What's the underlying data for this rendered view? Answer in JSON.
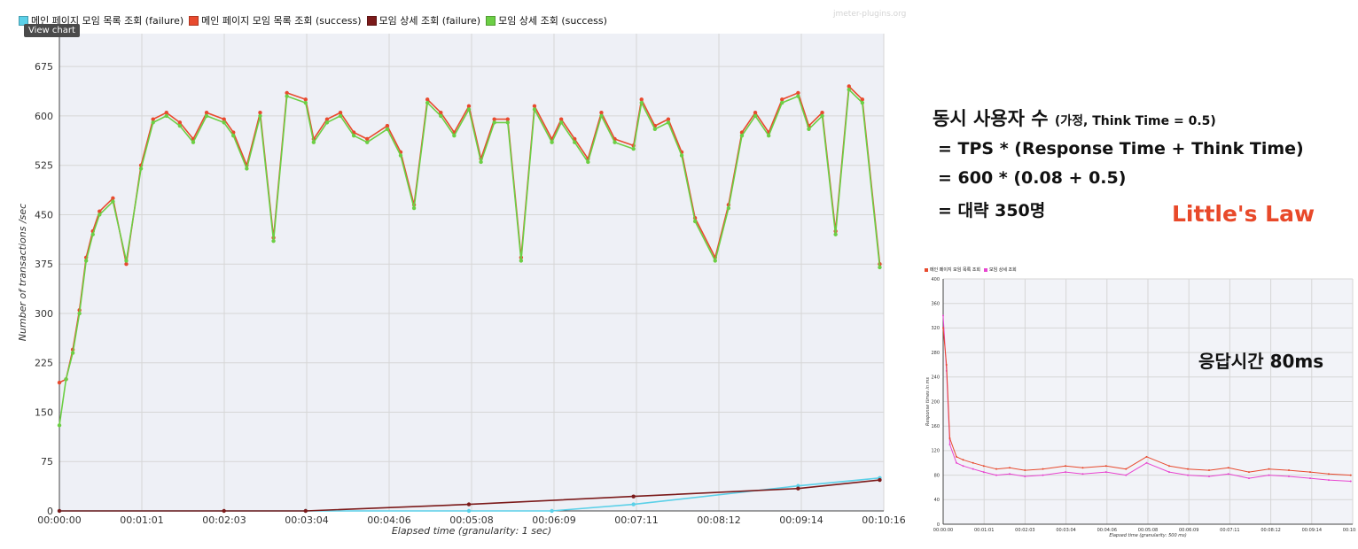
{
  "main_chart": {
    "legend": [
      {
        "label": "메인 페이지 모임 목록 조회 (failure)",
        "color": "#5bd0e8"
      },
      {
        "label": "메인 페이지 모임 목록 조회 (success)",
        "color": "#e84a2e"
      },
      {
        "label": "모임 상세 조회 (failure)",
        "color": "#7b1a1a"
      },
      {
        "label": "모임 상세 조회 (success)",
        "color": "#6ccf45"
      }
    ],
    "view_chart_label": "View chart",
    "watermark": "jmeter-plugins.org",
    "ylabel": "Number of transactions /sec",
    "xlabel": "Elapsed time (granularity: 1 sec)",
    "y_ticks": [
      "0",
      "75",
      "150",
      "225",
      "300",
      "375",
      "450",
      "525",
      "600",
      "675"
    ],
    "x_ticks": [
      "00:00:00",
      "00:01:01",
      "00:02:03",
      "00:03:04",
      "00:04:06",
      "00:05:08",
      "00:06:09",
      "00:07:11",
      "00:08:12",
      "00:09:14",
      "00:10:16"
    ]
  },
  "chart_data": [
    {
      "type": "line",
      "title": "",
      "xlabel": "Elapsed time (granularity: 1 sec)",
      "ylabel": "Number of transactions /sec",
      "x_unit": "seconds",
      "xlim": [
        0,
        616
      ],
      "ylim": [
        0,
        725
      ],
      "grid": true,
      "legend_position": "top-left",
      "series": [
        {
          "name": "모임 상세 조회 (success)",
          "color": "#6ccf45",
          "x": [
            0,
            5,
            10,
            15,
            20,
            25,
            30,
            40,
            50,
            61,
            70,
            80,
            90,
            100,
            110,
            123,
            130,
            140,
            150,
            160,
            170,
            184,
            190,
            200,
            210,
            220,
            230,
            245,
            255,
            265,
            275,
            285,
            295,
            306,
            315,
            325,
            335,
            345,
            355,
            368,
            375,
            385,
            395,
            405,
            415,
            429,
            435,
            445,
            455,
            465,
            475,
            490,
            500,
            510,
            520,
            530,
            540,
            552,
            560,
            570,
            580,
            590,
            600,
            613
          ],
          "y": [
            130,
            200,
            240,
            300,
            380,
            420,
            450,
            470,
            380,
            520,
            590,
            600,
            585,
            560,
            600,
            590,
            570,
            520,
            600,
            410,
            630,
            620,
            560,
            590,
            600,
            570,
            560,
            580,
            540,
            460,
            620,
            600,
            570,
            610,
            530,
            590,
            590,
            380,
            610,
            560,
            590,
            560,
            530,
            600,
            560,
            550,
            620,
            580,
            590,
            540,
            440,
            380,
            460,
            570,
            600,
            570,
            620,
            630,
            580,
            600,
            420,
            640,
            620,
            370
          ]
        },
        {
          "name": "메인 페이지 모임 목록 조회 (success)",
          "color": "#e84a2e",
          "x": [
            0,
            5,
            10,
            15,
            20,
            25,
            30,
            40,
            50,
            61,
            70,
            80,
            90,
            100,
            110,
            123,
            130,
            140,
            150,
            160,
            170,
            184,
            190,
            200,
            210,
            220,
            230,
            245,
            255,
            265,
            275,
            285,
            295,
            306,
            315,
            325,
            335,
            345,
            355,
            368,
            375,
            385,
            395,
            405,
            415,
            429,
            435,
            445,
            455,
            465,
            475,
            490,
            500,
            510,
            520,
            530,
            540,
            552,
            560,
            570,
            580,
            590,
            600,
            613
          ],
          "y": [
            195,
            200,
            245,
            305,
            385,
            425,
            455,
            475,
            375,
            525,
            595,
            605,
            590,
            565,
            605,
            595,
            575,
            525,
            605,
            415,
            635,
            625,
            565,
            595,
            605,
            575,
            565,
            585,
            545,
            465,
            625,
            605,
            575,
            615,
            535,
            595,
            595,
            385,
            615,
            565,
            595,
            565,
            535,
            605,
            565,
            555,
            625,
            585,
            595,
            545,
            445,
            385,
            465,
            575,
            605,
            575,
            625,
            635,
            585,
            605,
            425,
            645,
            625,
            375
          ]
        },
        {
          "name": "모임 상세 조회 (failure)",
          "color": "#7b1a1a",
          "x": [
            0,
            123,
            184,
            306,
            429,
            552,
            613
          ],
          "y": [
            0,
            0,
            0,
            10,
            22,
            34,
            47
          ]
        },
        {
          "name": "메인 페이지 모임 목록 조회 (failure)",
          "color": "#5bd0e8",
          "x": [
            0,
            184,
            306,
            368,
            429,
            552,
            613
          ],
          "y": [
            0,
            0,
            0,
            0,
            10,
            38,
            50
          ]
        }
      ]
    },
    {
      "type": "line",
      "title": "",
      "xlabel": "Elapsed time (granularity: 500 ms)",
      "ylabel": "Response times in ms",
      "ylim": [
        0,
        400
      ],
      "y_ticks": [
        "0",
        "40",
        "80",
        "120",
        "160",
        "200",
        "240",
        "280",
        "320",
        "360",
        "400"
      ],
      "x_ticks": [
        "00:00:00",
        "00:01:01",
        "00:02:03",
        "00:03:04",
        "00:04:06",
        "00:05:08",
        "00:06:09",
        "00:07:11",
        "00:08:12",
        "00:09:14",
        "00:10:16"
      ],
      "legend_position": "top-left",
      "series": [
        {
          "name": "메인 페이지 모임 목록 조회",
          "color": "#e84a2e",
          "x": [
            0,
            5,
            10,
            20,
            30,
            45,
            61,
            80,
            100,
            123,
            150,
            184,
            210,
            245,
            275,
            306,
            340,
            368,
            400,
            429,
            460,
            490,
            520,
            552,
            580,
            613
          ],
          "y": [
            320,
            260,
            140,
            110,
            105,
            100,
            95,
            90,
            92,
            88,
            90,
            95,
            92,
            95,
            90,
            110,
            95,
            90,
            88,
            92,
            85,
            90,
            88,
            85,
            82,
            80
          ]
        },
        {
          "name": "모임 상세 조회",
          "color": "#e845d0",
          "x": [
            0,
            5,
            10,
            20,
            30,
            45,
            61,
            80,
            100,
            123,
            150,
            184,
            210,
            245,
            275,
            306,
            340,
            368,
            400,
            429,
            460,
            490,
            520,
            552,
            580,
            613
          ],
          "y": [
            340,
            250,
            130,
            100,
            95,
            90,
            85,
            80,
            82,
            78,
            80,
            85,
            82,
            85,
            80,
            100,
            85,
            80,
            78,
            82,
            75,
            80,
            78,
            75,
            72,
            70
          ]
        }
      ]
    }
  ],
  "small_chart": {
    "legend": [
      {
        "label": "메인 페이지 모임 목록 조회",
        "color": "#e84a2e"
      },
      {
        "label": "모임 상세 조회",
        "color": "#e845d0"
      }
    ],
    "ylabel": "Response times in ms",
    "xlabel": "Elapsed time (granularity: 500 ms)"
  },
  "formula": {
    "line1_main": "동시 사용자 수",
    "line1_note": "(가정, Think Time = 0.5)",
    "line2": "= TPS * (Response Time + Think Time)",
    "line3": "= 600 * (0.08 + 0.5)",
    "line4": "= 대략 350명"
  },
  "little_law": "Little's Law",
  "response_time_label": "응답시간 80ms"
}
